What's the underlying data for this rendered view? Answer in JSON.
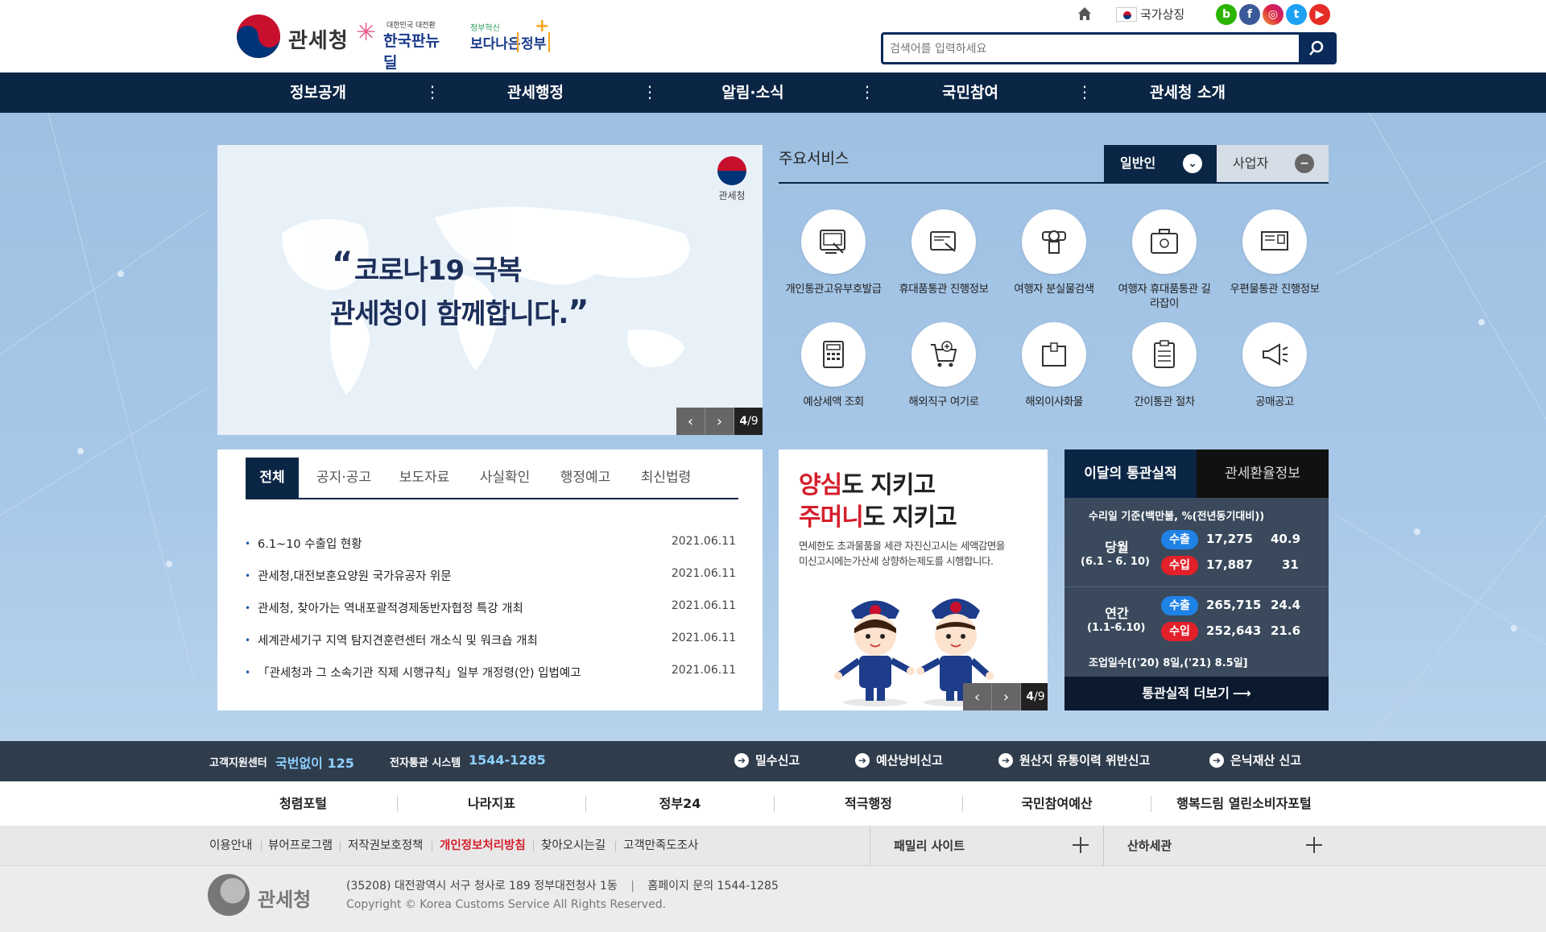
{
  "header": {
    "logo_text": "관세청",
    "newdeal_small": "대한민국 대전환",
    "newdeal_text": "한국판뉴딜",
    "gov_small": "정부혁신",
    "gov_text_a": "보다나은",
    "gov_text_b": "정부",
    "national_symbol": "국가상징",
    "search_placeholder": "검색어를 입력하세요"
  },
  "gnb": [
    "정보공개",
    "관세행정",
    "알림·소식",
    "국민참여",
    "관세청 소개"
  ],
  "visual": {
    "line1": "코로나19 극복",
    "line2": "관세청이 함께합니다.",
    "logo_label": "관세청",
    "page_current": "4",
    "page_total": "/9"
  },
  "services": {
    "title": "주요서비스",
    "tab_general": "일반인",
    "tab_business": "사업자",
    "items": [
      {
        "label": "개인통관고유부호발급",
        "icon": "id-card-icon"
      },
      {
        "label": "휴대품통관 진행정보",
        "icon": "luggage-card-icon"
      },
      {
        "label": "여행자 분실물검색",
        "icon": "lost-search-icon"
      },
      {
        "label": "여행자 휴대품통관 길라잡이",
        "icon": "suitcase-icon"
      },
      {
        "label": "우편물통관 진행정보",
        "icon": "mail-icon"
      },
      {
        "label": "예상세액 조회",
        "icon": "calculator-icon"
      },
      {
        "label": "해외직구 여기로",
        "icon": "cart-icon"
      },
      {
        "label": "해외이사화물",
        "icon": "box-icon"
      },
      {
        "label": "간이통관 절차",
        "icon": "clipboard-icon"
      },
      {
        "label": "공매공고",
        "icon": "megaphone-icon"
      }
    ]
  },
  "notice": {
    "tabs": [
      "전체",
      "공지·공고",
      "보도자료",
      "사실확인",
      "행정예고",
      "최신법령"
    ],
    "rows": [
      {
        "title": "6.1~10 수출입 현황",
        "date": "2021.06.11"
      },
      {
        "title": "관세청,대전보훈요양원 국가유공자 위문",
        "date": "2021.06.11"
      },
      {
        "title": "관세청, 찾아가는 역내포괄적경제동반자협정 특강 개최",
        "date": "2021.06.11"
      },
      {
        "title": "세계관세기구 지역 탐지견훈련센터 개소식 및 워크숍 개최",
        "date": "2021.06.11"
      },
      {
        "title": "「관세청과 그 소속기관 직제 시행규칙」일부 개정령(안) 입법예고",
        "date": "2021.06.11"
      }
    ]
  },
  "promo": {
    "line1_red": "양심",
    "line1_rest": "도 지키고",
    "line2_red": "주머니",
    "line2_rest": "도 지키고",
    "desc1": "면세한도 초과물품을 세관 자진신고시는 세액감면을",
    "desc2": "미신고시에는가산세 상향하는제도를 시행합니다.",
    "page_current": "4",
    "page_total": "/9"
  },
  "stats": {
    "tab1": "이달의 통관실적",
    "tab2": "관세환율정보",
    "basis": "수리일 기준(백만불, %(전년동기대비))",
    "month_label": "당월",
    "month_range": "(6.1 - 6. 10)",
    "year_label": "연간",
    "year_range": "(1.1-6.10)",
    "export_label": "수출",
    "import_label": "수입",
    "month_export": "17,275",
    "month_export_pct": "40.9",
    "month_import": "17,887",
    "month_import_pct": "31",
    "year_export": "265,715",
    "year_export_pct": "24.4",
    "year_import": "252,643",
    "year_import_pct": "21.6",
    "workdays": "조업일수[('20) 8일,('21) 8.5일]",
    "more": "통관실적 더보기"
  },
  "infobar": {
    "cs_label": "고객지원센터",
    "cs_number": "국번없이 125",
    "edi_label": "전자통관 시스템",
    "edi_number": "1544-1285",
    "reports": [
      "밀수신고",
      "예산낭비신고",
      "원산지 유통이력 위반신고",
      "은닉재산 신고"
    ]
  },
  "links": [
    "청렴포털",
    "나라지표",
    "정부24",
    "적극행정",
    "국민참여예산",
    "행복드림 열린소비자포털"
  ],
  "policy": {
    "items": [
      "이용안내",
      "뷰어프로그램",
      "저작권보호정책",
      "개인정보처리방침",
      "찾아오시는길",
      "고객만족도조사"
    ],
    "family": "패밀리 사이트",
    "branch": "산하세관"
  },
  "footer": {
    "logo_text": "관세청",
    "address": "(35208) 대전광역시 서구 청사로 189 정부대전청사 1동",
    "contact": "홈페이지 문의 1544-1285",
    "copyright": "Copyright © Korea Customs Service All Rights Reserved."
  },
  "colors": {
    "navy": "#0b2545",
    "export_blue": "#1f82e6",
    "import_red": "#e2202a",
    "policy_red": "#d61f2c"
  }
}
